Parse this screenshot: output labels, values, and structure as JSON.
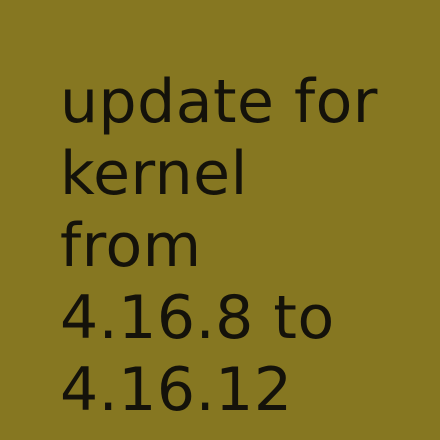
{
  "background_color": "#867721",
  "text_color": "#14120a",
  "message": {
    "lines": [
      "update for",
      "kernel",
      "from",
      "4.16.8 to",
      "4.16.12"
    ]
  }
}
